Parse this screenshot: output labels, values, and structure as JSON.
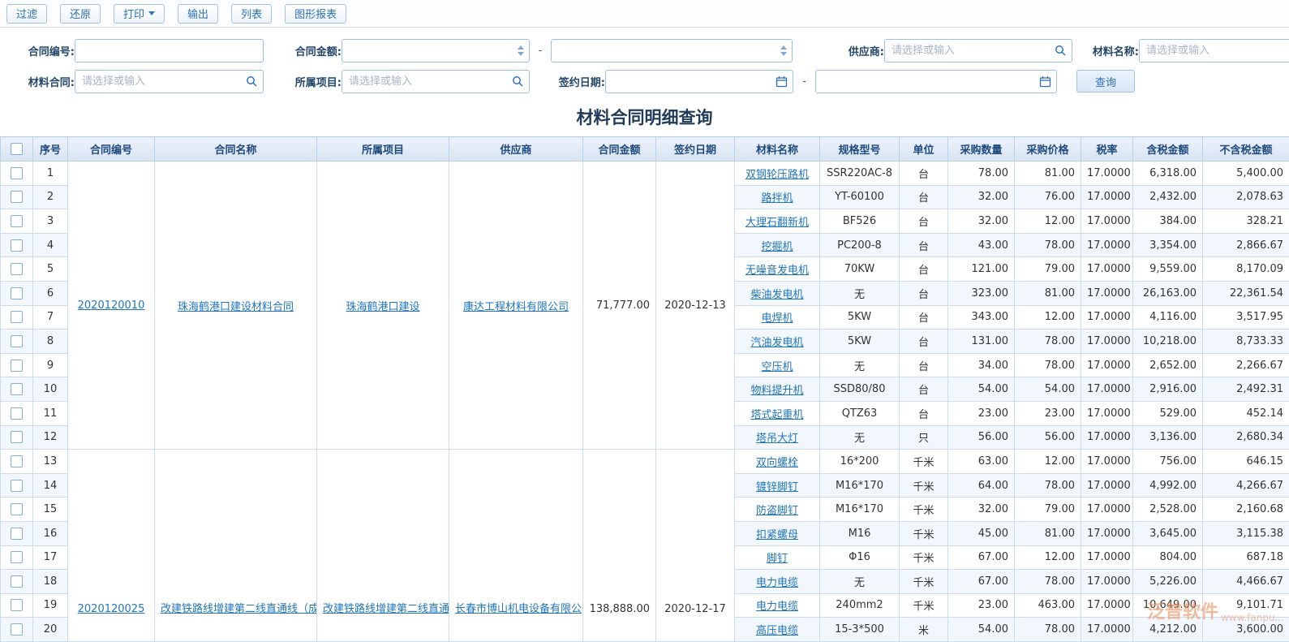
{
  "toolbar": {
    "buttons": [
      {
        "label": "过滤"
      },
      {
        "label": "还原"
      },
      {
        "label": "打印"
      },
      {
        "label": "输出"
      },
      {
        "label": "列表"
      },
      {
        "label": "图形报表"
      }
    ]
  },
  "filters": {
    "contract_no_label": "合同编号:",
    "contract_amount_label": "合同金额:",
    "supplier_label": "供应商:",
    "material_name_label": "材料名称:",
    "material_contract_label": "材料合同:",
    "project_label": "所属项目:",
    "sign_date_label": "签约日期:",
    "select_placeholder": "请选择或输入",
    "range_separator": "-",
    "query_button": "查询"
  },
  "page_title": "材料合同明细查询",
  "table": {
    "headers": [
      "序号",
      "合同编号",
      "合同名称",
      "所属项目",
      "供应商",
      "合同金额",
      "签约日期",
      "材料名称",
      "规格型号",
      "单位",
      "采购数量",
      "采购价格",
      "税率",
      "含税金额",
      "不含税金额"
    ],
    "groups": [
      {
        "contract_no": "2020120010",
        "contract_name": "珠海鹤港口建设材料合同",
        "project": "珠海鹤港口建设",
        "supplier": "康达工程材料有限公司",
        "amount": "71,777.00",
        "sign_date": "2020-12-13",
        "rows": [
          {
            "no": "1",
            "material": "双钢轮压路机",
            "spec": "SSR220AC-8",
            "unit": "台",
            "qty": "78.00",
            "price": "81.00",
            "tax_rate": "17.0000",
            "tax_amount": "6,318.00",
            "no_tax_amount": "5,400.00"
          },
          {
            "no": "2",
            "material": "路拌机",
            "spec": "YT-60100",
            "unit": "台",
            "qty": "32.00",
            "price": "76.00",
            "tax_rate": "17.0000",
            "tax_amount": "2,432.00",
            "no_tax_amount": "2,078.63"
          },
          {
            "no": "3",
            "material": "大理石翻新机",
            "spec": "BF526",
            "unit": "台",
            "qty": "32.00",
            "price": "12.00",
            "tax_rate": "17.0000",
            "tax_amount": "384.00",
            "no_tax_amount": "328.21"
          },
          {
            "no": "4",
            "material": "挖掘机",
            "spec": "PC200-8",
            "unit": "台",
            "qty": "43.00",
            "price": "78.00",
            "tax_rate": "17.0000",
            "tax_amount": "3,354.00",
            "no_tax_amount": "2,866.67"
          },
          {
            "no": "5",
            "material": "无噪音发电机",
            "spec": "70KW",
            "unit": "台",
            "qty": "121.00",
            "price": "79.00",
            "tax_rate": "17.0000",
            "tax_amount": "9,559.00",
            "no_tax_amount": "8,170.09"
          },
          {
            "no": "6",
            "material": "柴油发电机",
            "spec": "无",
            "unit": "台",
            "qty": "323.00",
            "price": "81.00",
            "tax_rate": "17.0000",
            "tax_amount": "26,163.00",
            "no_tax_amount": "22,361.54"
          },
          {
            "no": "7",
            "material": "电焊机",
            "spec": "5KW",
            "unit": "台",
            "qty": "343.00",
            "price": "12.00",
            "tax_rate": "17.0000",
            "tax_amount": "4,116.00",
            "no_tax_amount": "3,517.95"
          },
          {
            "no": "8",
            "material": "汽油发电机",
            "spec": "5KW",
            "unit": "台",
            "qty": "131.00",
            "price": "78.00",
            "tax_rate": "17.0000",
            "tax_amount": "10,218.00",
            "no_tax_amount": "8,733.33"
          },
          {
            "no": "9",
            "material": "空压机",
            "spec": "无",
            "unit": "台",
            "qty": "34.00",
            "price": "78.00",
            "tax_rate": "17.0000",
            "tax_amount": "2,652.00",
            "no_tax_amount": "2,266.67"
          },
          {
            "no": "10",
            "material": "物料提升机",
            "spec": "SSD80/80",
            "unit": "台",
            "qty": "54.00",
            "price": "54.00",
            "tax_rate": "17.0000",
            "tax_amount": "2,916.00",
            "no_tax_amount": "2,492.31"
          },
          {
            "no": "11",
            "material": "塔式起重机",
            "spec": "QTZ63",
            "unit": "台",
            "qty": "23.00",
            "price": "23.00",
            "tax_rate": "17.0000",
            "tax_amount": "529.00",
            "no_tax_amount": "452.14"
          },
          {
            "no": "12",
            "material": "塔吊大灯",
            "spec": "无",
            "unit": "只",
            "qty": "56.00",
            "price": "56.00",
            "tax_rate": "17.0000",
            "tax_amount": "3,136.00",
            "no_tax_amount": "2,680.34"
          }
        ]
      },
      {
        "contract_no": "2020120025",
        "contract_name": "改建铁路线增建第二线直通线（成",
        "project": "改建铁路线增建第二线直通",
        "supplier": "长春市博山机电设备有限公",
        "amount": "138,888.00",
        "sign_date": "2020-12-17",
        "rows": [
          {
            "no": "13",
            "material": "双向螺栓",
            "spec": "16*200",
            "unit": "千米",
            "qty": "63.00",
            "price": "12.00",
            "tax_rate": "17.0000",
            "tax_amount": "756.00",
            "no_tax_amount": "646.15"
          },
          {
            "no": "14",
            "material": "镀锌脚钉",
            "spec": "M16*170",
            "unit": "千米",
            "qty": "64.00",
            "price": "78.00",
            "tax_rate": "17.0000",
            "tax_amount": "4,992.00",
            "no_tax_amount": "4,266.67"
          },
          {
            "no": "15",
            "material": "防盗脚钉",
            "spec": "M16*170",
            "unit": "千米",
            "qty": "32.00",
            "price": "79.00",
            "tax_rate": "17.0000",
            "tax_amount": "2,528.00",
            "no_tax_amount": "2,160.68"
          },
          {
            "no": "16",
            "material": "扣紧螺母",
            "spec": "M16",
            "unit": "千米",
            "qty": "45.00",
            "price": "81.00",
            "tax_rate": "17.0000",
            "tax_amount": "3,645.00",
            "no_tax_amount": "3,115.38"
          },
          {
            "no": "17",
            "material": "脚钉",
            "spec": "Φ16",
            "unit": "千米",
            "qty": "67.00",
            "price": "12.00",
            "tax_rate": "17.0000",
            "tax_amount": "804.00",
            "no_tax_amount": "687.18"
          },
          {
            "no": "18",
            "material": "电力电缆",
            "spec": "无",
            "unit": "千米",
            "qty": "67.00",
            "price": "78.00",
            "tax_rate": "17.0000",
            "tax_amount": "5,226.00",
            "no_tax_amount": "4,466.67"
          },
          {
            "no": "19",
            "material": "电力电缆",
            "spec": "240mm2",
            "unit": "千米",
            "qty": "23.00",
            "price": "463.00",
            "tax_rate": "17.0000",
            "tax_amount": "10,649.00",
            "no_tax_amount": "9,101.71"
          },
          {
            "no": "20",
            "material": "高压电缆",
            "spec": "15-3*500",
            "unit": "米",
            "qty": "54.00",
            "price": "78.00",
            "tax_rate": "17.0000",
            "tax_amount": "4,212.00",
            "no_tax_amount": "3,600.00"
          }
        ]
      }
    ]
  },
  "watermark": {
    "text": "泛普软件",
    "sub": "www.fanpu..."
  }
}
